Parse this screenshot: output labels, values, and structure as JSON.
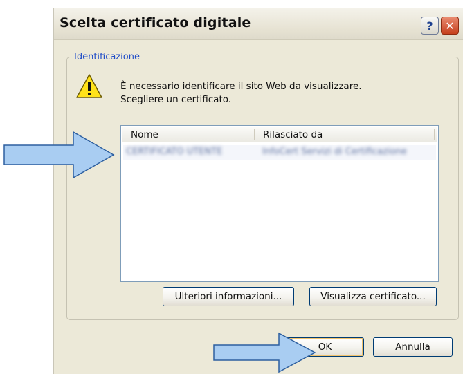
{
  "dialog": {
    "title": "Scelta certificato digitale",
    "help_label": "?",
    "close_label": "✕"
  },
  "group": {
    "legend": "Identificazione",
    "message_line1": "È necessario identificare il sito Web da visualizzare.",
    "message_line2": "Scegliere un certificato."
  },
  "list": {
    "columns": [
      "Nome",
      "Rilasciato da"
    ],
    "rows": [
      {
        "name": "CERTIFICATO UTENTE",
        "issuer": "InfoCert Servizi di Certificazione"
      }
    ]
  },
  "buttons": {
    "more_info": "Ulteriori informazioni...",
    "view_certificate": "Visualizza certificato...",
    "ok": "OK",
    "cancel": "Annulla"
  },
  "icons": {
    "warning": "warning-icon",
    "help": "help-icon",
    "close": "close-icon"
  },
  "colors": {
    "dialog_bg": "#ece9d8",
    "legend_text": "#1f4cc8",
    "close_button": "#c6401e",
    "arrow_fill": "#a9cdf2",
    "arrow_stroke": "#2d5f9f"
  }
}
